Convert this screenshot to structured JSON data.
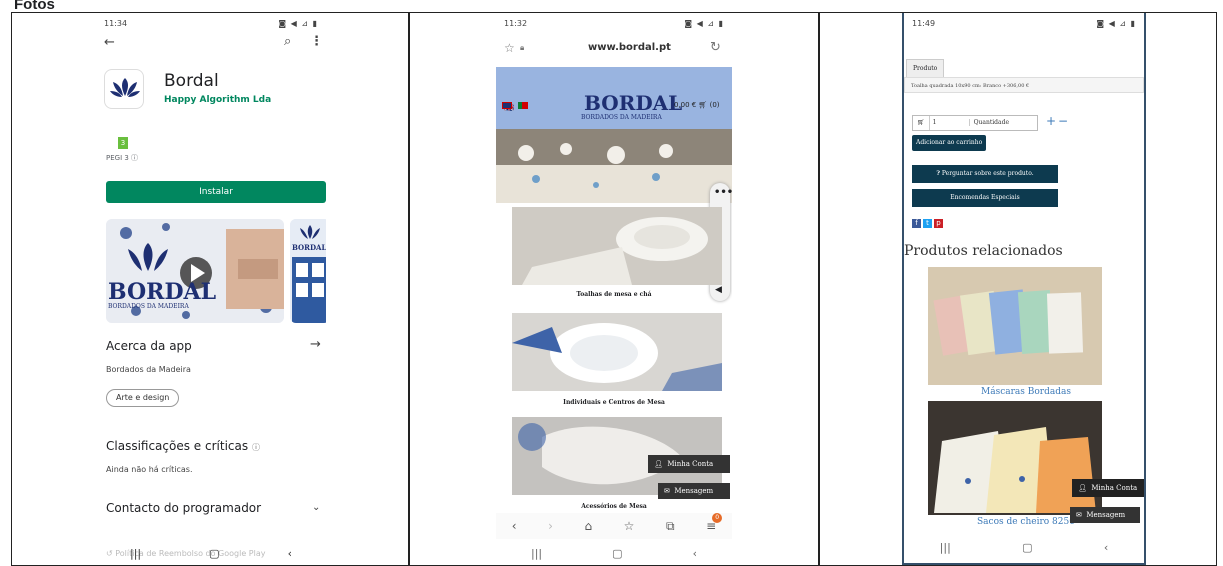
{
  "heading": "Fotos",
  "phone1": {
    "time": "11:34",
    "app_name": "Bordal",
    "developer": "Happy Algorithm Lda",
    "pegi": "PEGI 3",
    "install": "Instalar",
    "about_title": "Acerca da app",
    "about_desc": "Bordados da Madeira",
    "category": "Arte e design",
    "ratings_title": "Classificações e críticas",
    "ratings_desc": "Ainda não há críticas.",
    "contact": "Contacto do programador",
    "policy": "Política de Reembolso do Google Play",
    "banner_word": "BORDAL",
    "banner_sub": "BORDADOS DA MADEIRA",
    "shot_word": "BORDAL"
  },
  "phone2": {
    "time": "11:32",
    "url": "www.bordal.pt",
    "logo": "BORDAL",
    "logo_sub": "BORDADOS DA MADEIRA",
    "cart": "0,00 €",
    "cart_count": "(0)",
    "products": [
      "Toalhas de mesa e chá",
      "Individuais e Centros de Mesa",
      "Acessórios de Mesa"
    ],
    "account": "Minha Conta",
    "message": "Mensagem",
    "badge": "0"
  },
  "phone3": {
    "time": "11:49",
    "tab": "Produto",
    "variant": "Toalha quadrada 10x90 cm: Branco +306,00 €",
    "qty": "1",
    "qty_label": "Quantidade",
    "add_cart": "Adicionar ao carrinho",
    "ask": "Perguntar sobre este produto.",
    "special": "Encomendas Especiais",
    "related": "Produtos relacionados",
    "item1": "Máscaras Bordadas",
    "item2": "Sacos de cheiro 8250",
    "account": "Minha Conta",
    "message": "Mensagem"
  },
  "colors": {
    "play_green": "#01875f",
    "navy": "#0d3a4f",
    "site_blue": "#99b4e0",
    "logo_navy": "#1e2f72",
    "link": "#3d7ab8"
  }
}
